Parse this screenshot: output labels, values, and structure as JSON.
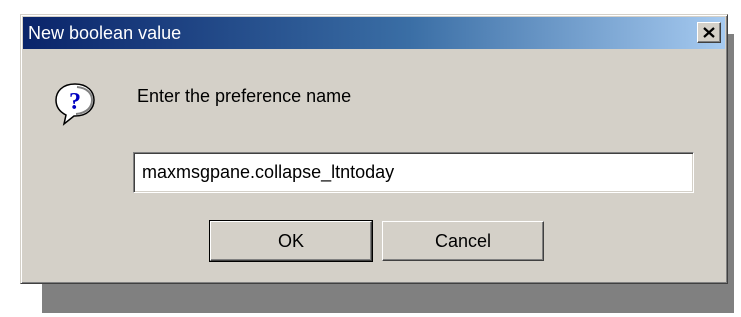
{
  "window": {
    "title": "New boolean value",
    "close_icon": "close-icon"
  },
  "prompt": {
    "icon": "question-icon",
    "text": "Enter the preference name"
  },
  "input": {
    "value": "maxmsgpane.collapse_ltntoday"
  },
  "buttons": {
    "ok_label": "OK",
    "cancel_label": "Cancel"
  },
  "colors": {
    "title_gradient_start": "#0a246a",
    "title_gradient_end": "#a6caf0",
    "dialog_face": "#d4d0c8"
  }
}
